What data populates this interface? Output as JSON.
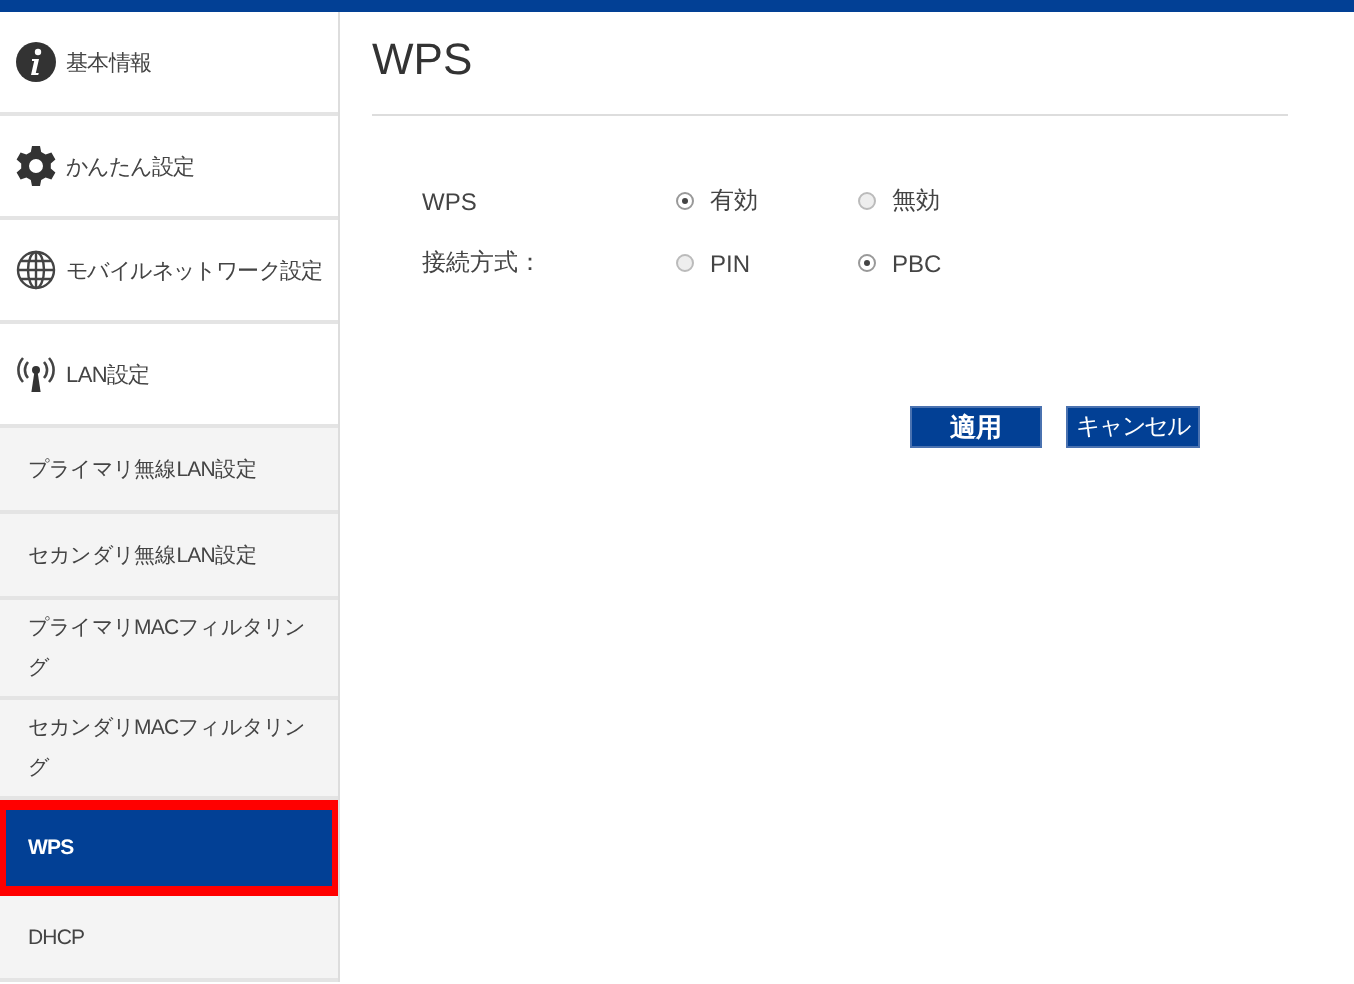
{
  "sidebar": {
    "items": [
      {
        "label": "基本情報",
        "kind": "main",
        "selected": false
      },
      {
        "label": "かんたん設定",
        "kind": "main",
        "selected": false
      },
      {
        "label": "モバイルネットワーク設定",
        "kind": "main",
        "selected": false
      },
      {
        "label": "LAN設定",
        "kind": "main",
        "selected": false
      },
      {
        "label": "プライマリ無線LAN設定",
        "kind": "sub",
        "selected": false
      },
      {
        "label": "セカンダリ無線LAN設定",
        "kind": "sub",
        "selected": false
      },
      {
        "label": "プライマリMACフィルタリング",
        "kind": "sub",
        "selected": false
      },
      {
        "label": "セカンダリMACフィルタリング",
        "kind": "sub",
        "selected": false
      },
      {
        "label": "WPS",
        "kind": "sub",
        "selected": true,
        "highlighted": true
      },
      {
        "label": "DHCP",
        "kind": "sub",
        "selected": false
      }
    ]
  },
  "page": {
    "title": "WPS",
    "fields": [
      {
        "label": "WPS",
        "options": [
          {
            "label": "有効",
            "selected": true
          },
          {
            "label": "無効",
            "selected": false
          }
        ]
      },
      {
        "label": "接続方式：",
        "options": [
          {
            "label": "PIN",
            "selected": false
          },
          {
            "label": "PBC",
            "selected": true
          }
        ]
      }
    ],
    "buttons": [
      "適用",
      "キャンセル"
    ]
  }
}
